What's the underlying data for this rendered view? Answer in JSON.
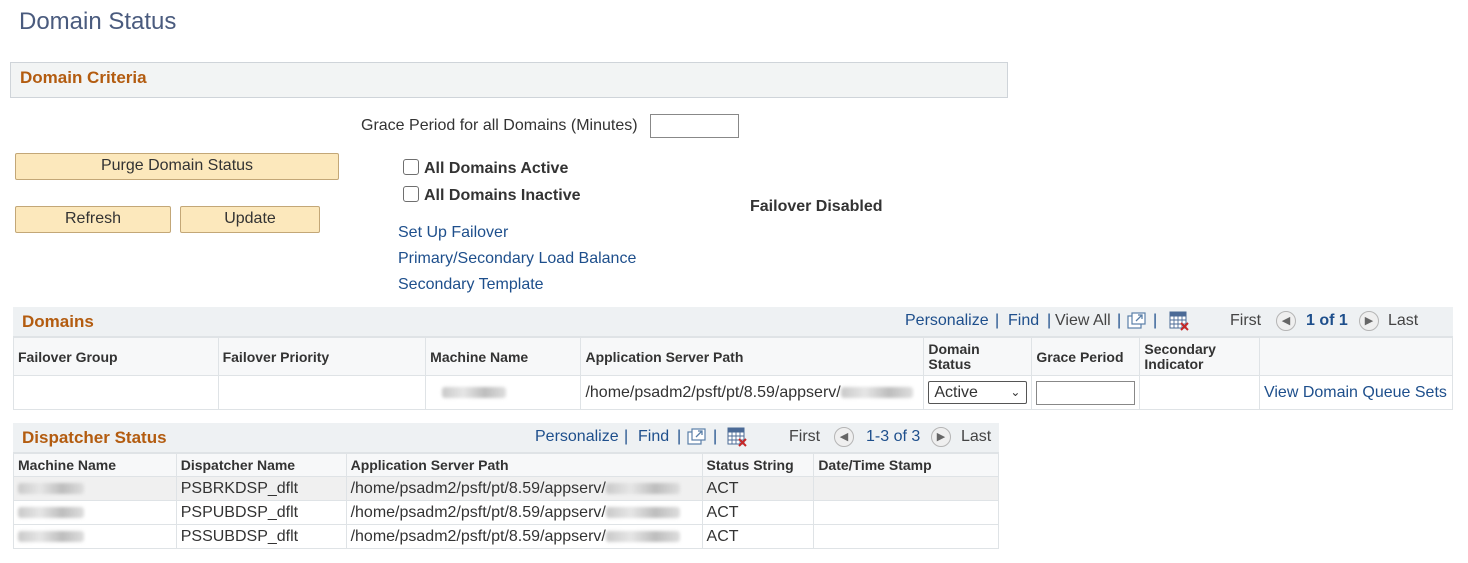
{
  "page": {
    "title": "Domain Status"
  },
  "criteria": {
    "section_title": "Domain Criteria",
    "grace_label": "Grace Period for all Domains (Minutes)",
    "grace_value": "",
    "purge_button": "Purge Domain Status",
    "refresh_button": "Refresh",
    "update_button": "Update",
    "all_active_label": "All Domains Active",
    "all_active_checked": false,
    "all_inactive_label": "All Domains Inactive",
    "all_inactive_checked": false,
    "failover_status": "Failover Disabled",
    "links": {
      "setup_failover": "Set Up Failover",
      "load_balance": "Primary/Secondary Load Balance",
      "secondary_template": "Secondary Template"
    }
  },
  "domains": {
    "section_title": "Domains",
    "toolbar": {
      "personalize": "Personalize",
      "find": "Find",
      "view_all": "View All",
      "first": "First",
      "range": "1 of 1",
      "last": "Last"
    },
    "columns": {
      "failover_group": "Failover Group",
      "failover_priority": "Failover Priority",
      "machine_name": "Machine Name",
      "app_server_path": "Application Server Path",
      "domain_status_l1": "Domain",
      "domain_status_l2": "Status",
      "grace_period": "Grace Period",
      "secondary_l1": "Secondary",
      "secondary_l2": "Indicator"
    },
    "rows": [
      {
        "failover_group": "",
        "failover_priority": "",
        "app_server_path": "/home/psadm2/psft/pt/8.59/appserv/",
        "domain_status": "Active",
        "grace_period": "",
        "secondary_indicator": "",
        "link": "View Domain Queue Sets"
      }
    ]
  },
  "dispatcher": {
    "section_title": "Dispatcher Status",
    "toolbar": {
      "personalize": "Personalize",
      "find": "Find",
      "first": "First",
      "range": "1-3 of 3",
      "last": "Last"
    },
    "columns": {
      "machine_name": "Machine Name",
      "dispatcher_name": "Dispatcher Name",
      "app_server_path": "Application Server Path",
      "status_string": "Status String",
      "datetime": "Date/Time Stamp"
    },
    "rows": [
      {
        "dispatcher_name": "PSBRKDSP_dflt",
        "app_server_path": "/home/psadm2/psft/pt/8.59/appserv/",
        "status": "ACT",
        "datetime": ""
      },
      {
        "dispatcher_name": "PSPUBDSP_dflt",
        "app_server_path": "/home/psadm2/psft/pt/8.59/appserv/",
        "status": "ACT",
        "datetime": ""
      },
      {
        "dispatcher_name": "PSSUBDSP_dflt",
        "app_server_path": "/home/psadm2/psft/pt/8.59/appserv/",
        "status": "ACT",
        "datetime": ""
      }
    ]
  },
  "icons": {
    "new_window": "new-window-icon",
    "download": "download-grid-icon",
    "prev": "previous-arrow-icon",
    "next": "next-arrow-icon"
  },
  "colors": {
    "title": "#4a5b7e",
    "section": "#b35c10",
    "link": "#1e4f8c",
    "button_bg": "#fce8bc"
  }
}
